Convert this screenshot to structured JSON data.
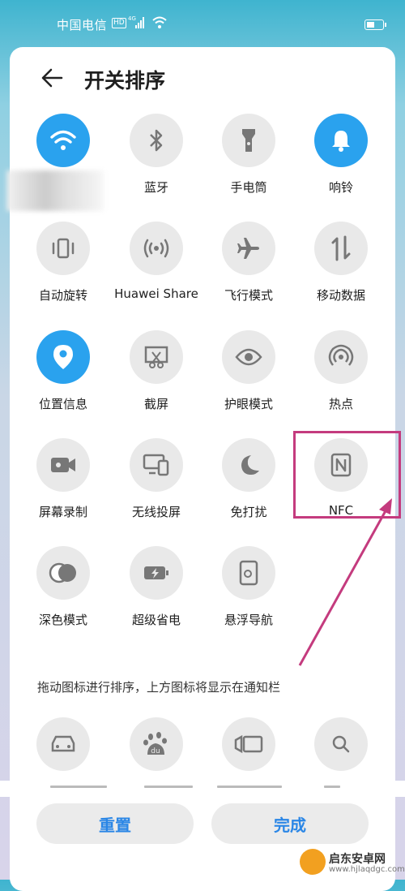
{
  "status_bar": {
    "carrier": "中国电信",
    "hd": "HD",
    "network": "4G"
  },
  "header": {
    "title": "开关排序",
    "back_icon": "arrow-left-icon"
  },
  "tiles": [
    {
      "label": "",
      "icon": "wifi-icon",
      "on": true
    },
    {
      "label": "蓝牙",
      "icon": "bluetooth-icon",
      "on": false
    },
    {
      "label": "手电筒",
      "icon": "flashlight-icon",
      "on": false
    },
    {
      "label": "响铃",
      "icon": "bell-icon",
      "on": true
    },
    {
      "label": "自动旋转",
      "icon": "auto-rotate-icon",
      "on": false
    },
    {
      "label": "Huawei Share",
      "icon": "huawei-share-icon",
      "on": false
    },
    {
      "label": "飞行模式",
      "icon": "airplane-icon",
      "on": false
    },
    {
      "label": "移动数据",
      "icon": "mobile-data-icon",
      "on": false
    },
    {
      "label": "位置信息",
      "icon": "location-icon",
      "on": true
    },
    {
      "label": "截屏",
      "icon": "screenshot-icon",
      "on": false
    },
    {
      "label": "护眼模式",
      "icon": "eye-icon",
      "on": false
    },
    {
      "label": "热点",
      "icon": "hotspot-icon",
      "on": false
    },
    {
      "label": "屏幕录制",
      "icon": "screen-record-icon",
      "on": false
    },
    {
      "label": "无线投屏",
      "icon": "wireless-projection-icon",
      "on": false
    },
    {
      "label": "免打扰",
      "icon": "moon-icon",
      "on": false
    },
    {
      "label": "NFC",
      "icon": "nfc-icon",
      "on": false
    },
    {
      "label": "深色模式",
      "icon": "dark-mode-icon",
      "on": false
    },
    {
      "label": "超级省电",
      "icon": "battery-saver-icon",
      "on": false
    },
    {
      "label": "悬浮导航",
      "icon": "floating-nav-icon",
      "on": false
    }
  ],
  "hint": "拖动图标进行排序，上方图标将显示在通知栏",
  "hidden_tiles": [
    {
      "icon": "car-icon"
    },
    {
      "icon": "baidu-icon"
    },
    {
      "icon": "video-icon"
    },
    {
      "icon": "search-icon"
    }
  ],
  "buttons": {
    "reset": "重置",
    "done": "完成"
  },
  "watermark": {
    "name": "启东安卓网",
    "url": "www.hjlaqdgc.com"
  },
  "colors": {
    "accent": "#2aa2ee",
    "highlight": "#c43b7e",
    "button_text": "#2a86e6"
  }
}
